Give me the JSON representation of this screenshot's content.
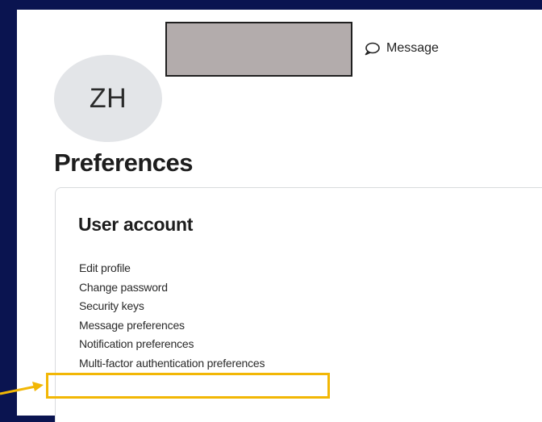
{
  "profile": {
    "initials": "ZH",
    "message_label": "Message"
  },
  "preferences": {
    "title": "Preferences",
    "user_account": {
      "title": "User account",
      "links": [
        "Edit profile",
        "Change password",
        "Security keys",
        "Message preferences",
        "Notification preferences",
        "Multi-factor authentication preferences"
      ]
    }
  },
  "colors": {
    "background": "#0a1450",
    "panel": "#ffffff",
    "avatar_bg": "#e3e5e8",
    "redaction": "#b3acac",
    "highlight": "#f2b705"
  },
  "icons": {
    "message": "speech-bubble-icon",
    "annotation": "arrow-right-icon"
  }
}
